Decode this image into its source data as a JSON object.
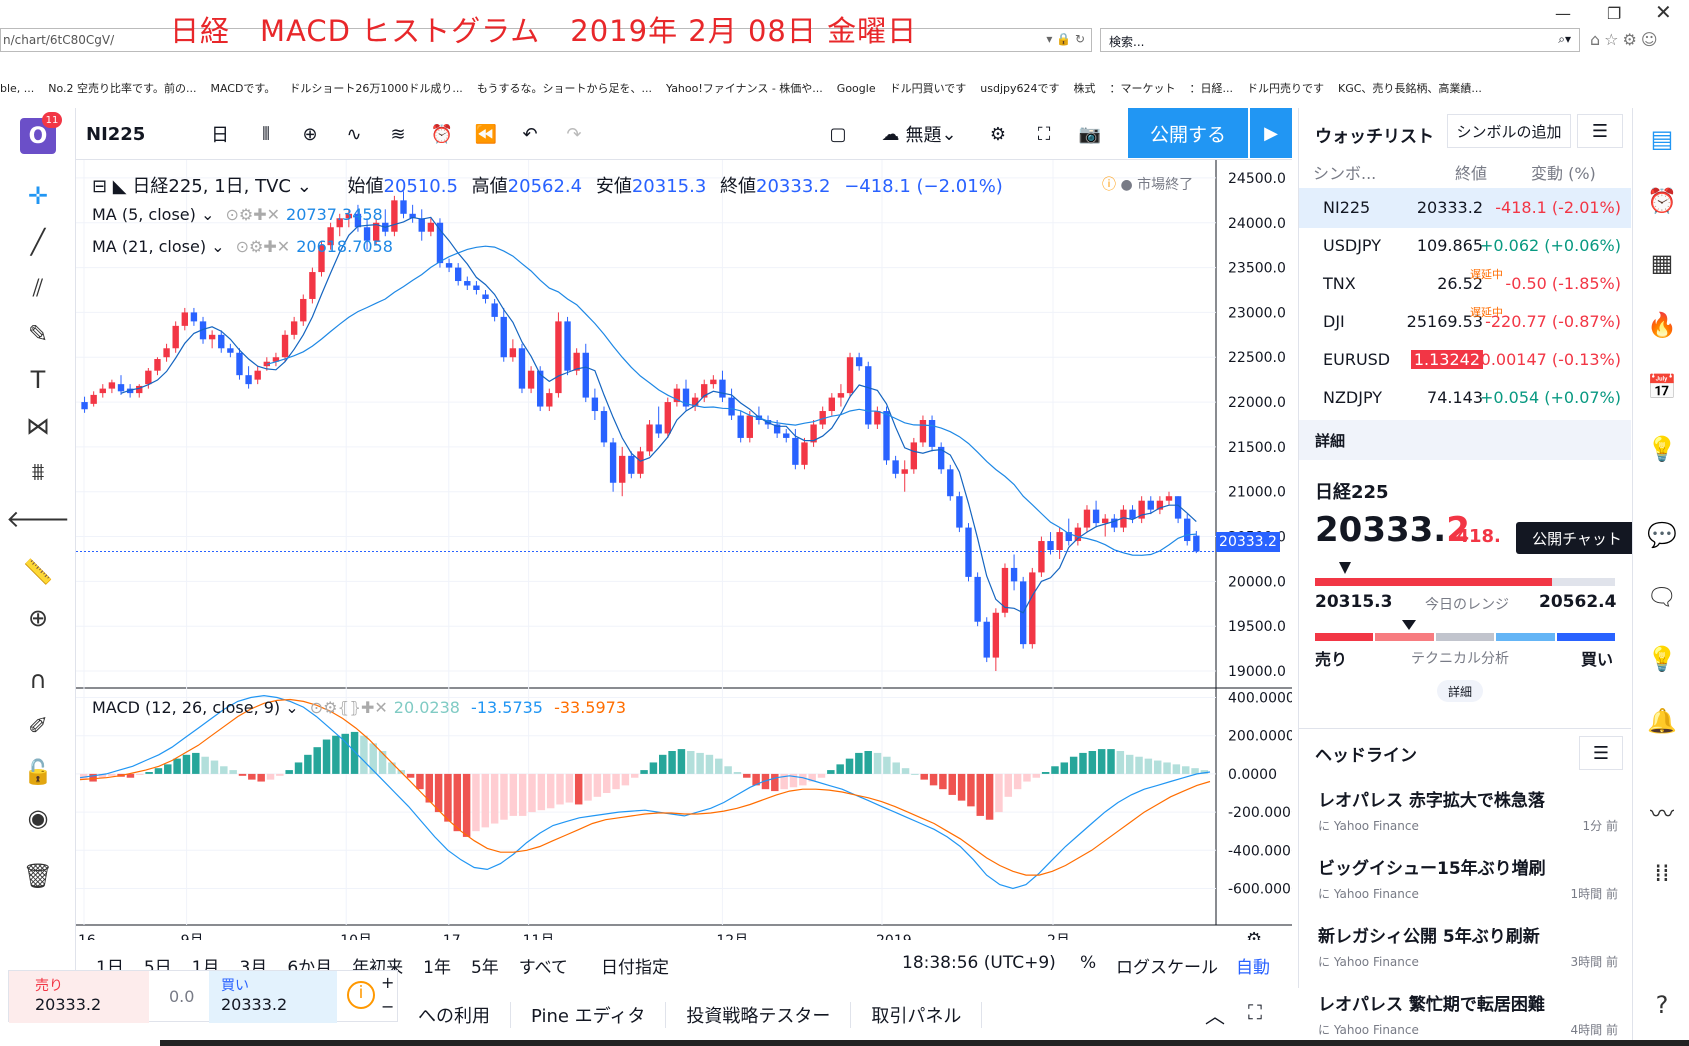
{
  "overlay_title": "日経　MACD ヒストグラム　2019年 2月 08日 金曜日",
  "browser": {
    "address": "n/chart/6tC80CgV/",
    "search_placeholder": "検索...",
    "bookmarks": [
      "ble, ...",
      "No.2 空売り比率です。前の...",
      "MACDです。",
      "ドルショート26万1000ドル成り...",
      "もうするな。ショートから足を、...",
      "Yahoo!ファイナンス - 株価や...",
      "Google",
      "ドル円買いです",
      "usdjpy624です",
      "株式",
      "：マーケット",
      "：日経...",
      "ドル円売りです",
      "KGC、売り長銘柄、高業績..."
    ]
  },
  "logo_badge": "11",
  "toolbar": {
    "symbol": "NI225",
    "interval": "日",
    "layout_name": "無題",
    "publish": "公開する"
  },
  "legend": {
    "symbol_line": "日経225, 1日, TVC",
    "open_label": "始値",
    "open": "20510.5",
    "high_label": "高値",
    "high": "20562.4",
    "low_label": "安値",
    "low": "20315.3",
    "close_label": "終値",
    "close": "20333.2",
    "change": "−418.1 (−2.01%)",
    "market_status": "市場終了",
    "ma5": "MA (5, close)",
    "ma5_val": "20737.3458",
    "ma21": "MA (21, close)",
    "ma21_val": "20618.7058",
    "macd": "MACD (12, 26, close, 9)",
    "macd_hist": "20.0238",
    "macd_line": "-13.5735",
    "macd_signal": "-33.5973"
  },
  "price_axis": [
    "24500.0",
    "24000.0",
    "23500.0",
    "23000.0",
    "22500.0",
    "22000.0",
    "21500.0",
    "21000.0",
    "20500.0",
    "20000.0",
    "19500.0",
    "19000.0"
  ],
  "last_price_tag": "20333.2",
  "macd_axis": [
    "400.0000",
    "200.0000",
    "0.0000",
    "-200.0000",
    "-400.0000",
    "-600.0000"
  ],
  "time_axis": [
    "16",
    "9月",
    "10月",
    "17",
    "11月",
    "12月",
    "2019",
    "2月"
  ],
  "range_buttons": [
    "1日",
    "5日",
    "1月",
    "3月",
    "6か月",
    "年初来",
    "1年",
    "5年",
    "すべて"
  ],
  "date_pick": "日付指定",
  "clock": "18:38:56 (UTC+9)",
  "scale_opts": {
    "percent": "%",
    "log": "ログスケール",
    "auto": "自動"
  },
  "trade": {
    "sell_label": "売り",
    "sell": "20333.2",
    "spread": "0.0",
    "buy_label": "買い",
    "buy": "20333.2"
  },
  "bottom_tabs": [
    "への利用",
    "Pine エディタ",
    "投資戦略テスター",
    "取引パネル"
  ],
  "watchlist": {
    "title": "ウォッチリスト",
    "add_symbol": "シンボルの追加",
    "col_symbol": "シンボ...",
    "col_last": "終値",
    "col_change": "変動 (%)",
    "rows": [
      {
        "sym": "NI225",
        "last": "20333.2",
        "chg": "-418.1 (-2.01%)",
        "color": "#f23645"
      },
      {
        "sym": "USDJPY",
        "last": "109.865",
        "chg": "+0.062 (+0.06%)",
        "color": "#089981"
      },
      {
        "sym": "TNX",
        "last": "26.52",
        "chg": "-0.50 (-1.85%)",
        "color": "#f23645",
        "tag": "遅延中"
      },
      {
        "sym": "DJI",
        "last": "25169.53",
        "chg": "-220.77 (-0.87%)",
        "color": "#f23645",
        "tag": "遅延中"
      },
      {
        "sym": "EURUSD",
        "last": "1.13242",
        "chg": "-0.00147 (-0.13%)",
        "color": "#f23645"
      },
      {
        "sym": "NZDJPY",
        "last": "74.143",
        "chg": "+0.054 (+0.07%)",
        "color": "#089981"
      }
    ]
  },
  "details": {
    "header": "詳細",
    "name": "日経225",
    "price_main": "20333.",
    "price_last": "2",
    "change": "-418.",
    "range_low": "20315.3",
    "range_label": "今日のレンジ",
    "range_high": "20562.4",
    "sell": "売り",
    "tech": "テクニカル分析",
    "buy": "買い",
    "more": "詳細"
  },
  "tooltip": "公開チャット",
  "headlines": {
    "title": "ヘッドライン",
    "items": [
      {
        "t": "レオパレス 赤字拡大で株急落",
        "src": "に Yahoo Finance",
        "time": "1分 前"
      },
      {
        "t": "ビッグイシュー15年ぶり増刷",
        "src": "に Yahoo Finance",
        "time": "1時間 前"
      },
      {
        "t": "新レガシィ公開 5年ぶり刷新",
        "src": "に Yahoo Finance",
        "time": "3時間 前"
      },
      {
        "t": "レオパレス 繁忙期で転居困難",
        "src": "に Yahoo Finance",
        "time": "4時間 前"
      }
    ]
  },
  "chart_data": {
    "type": "candlestick",
    "ylim": [
      18900,
      24700
    ],
    "macd_ylim": [
      -650,
      450
    ],
    "candles": [
      [
        22000,
        22060,
        21880,
        21920
      ],
      [
        21980,
        22120,
        21950,
        22080
      ],
      [
        22100,
        22200,
        22050,
        22150
      ],
      [
        22150,
        22250,
        22100,
        22220
      ],
      [
        22200,
        22300,
        22080,
        22120
      ],
      [
        22150,
        22200,
        22050,
        22100
      ],
      [
        22100,
        22200,
        22050,
        22180
      ],
      [
        22200,
        22380,
        22150,
        22350
      ],
      [
        22350,
        22500,
        22300,
        22480
      ],
      [
        22500,
        22650,
        22450,
        22600
      ],
      [
        22600,
        22900,
        22550,
        22850
      ],
      [
        22850,
        23050,
        22800,
        23000
      ],
      [
        23000,
        23050,
        22850,
        22900
      ],
      [
        22900,
        22950,
        22650,
        22700
      ],
      [
        22700,
        22800,
        22600,
        22750
      ],
      [
        22750,
        22800,
        22550,
        22600
      ],
      [
        22600,
        22650,
        22500,
        22550
      ],
      [
        22550,
        22600,
        22250,
        22300
      ],
      [
        22300,
        22400,
        22150,
        22200
      ],
      [
        22250,
        22400,
        22200,
        22350
      ],
      [
        22400,
        22500,
        22350,
        22450
      ],
      [
        22450,
        22550,
        22400,
        22500
      ],
      [
        22500,
        22800,
        22450,
        22750
      ],
      [
        22750,
        22950,
        22700,
        22900
      ],
      [
        22900,
        23200,
        22850,
        23150
      ],
      [
        23150,
        23500,
        23100,
        23450
      ],
      [
        23450,
        23800,
        23400,
        23750
      ],
      [
        23750,
        24000,
        23700,
        23950
      ],
      [
        23950,
        24100,
        23850,
        24050
      ],
      [
        24050,
        24150,
        23950,
        24100
      ],
      [
        24100,
        24200,
        23900,
        23950
      ],
      [
        23950,
        24050,
        23700,
        23800
      ],
      [
        23800,
        24050,
        23750,
        24000
      ],
      [
        24000,
        24150,
        23850,
        23900
      ],
      [
        23900,
        24300,
        23850,
        24250
      ],
      [
        24250,
        24350,
        24050,
        24100
      ],
      [
        24100,
        24200,
        24000,
        24050
      ],
      [
        24050,
        24150,
        23800,
        23900
      ],
      [
        23900,
        24050,
        23850,
        24000
      ],
      [
        24000,
        24050,
        23500,
        23550
      ],
      [
        23550,
        23600,
        23450,
        23500
      ],
      [
        23500,
        23550,
        23300,
        23350
      ],
      [
        23350,
        23400,
        23250,
        23300
      ],
      [
        23300,
        23350,
        23200,
        23250
      ],
      [
        23200,
        23250,
        23100,
        23150
      ],
      [
        23100,
        23150,
        22900,
        22950
      ],
      [
        22950,
        23050,
        22450,
        22500
      ],
      [
        22500,
        22700,
        22450,
        22600
      ],
      [
        22600,
        22650,
        22100,
        22150
      ],
      [
        22150,
        22400,
        22100,
        22350
      ],
      [
        22350,
        22400,
        21900,
        21950
      ],
      [
        21950,
        22150,
        21900,
        22100
      ],
      [
        22100,
        23000,
        22050,
        22900
      ],
      [
        22900,
        22950,
        22300,
        22350
      ],
      [
        22350,
        22600,
        22300,
        22550
      ],
      [
        22550,
        22650,
        22000,
        22050
      ],
      [
        22050,
        22150,
        21800,
        21900
      ],
      [
        21900,
        21950,
        21500,
        21550
      ],
      [
        21550,
        21600,
        21000,
        21100
      ],
      [
        21100,
        21500,
        20950,
        21400
      ],
      [
        21400,
        21450,
        21150,
        21200
      ],
      [
        21200,
        21500,
        21150,
        21450
      ],
      [
        21450,
        21800,
        21400,
        21750
      ],
      [
        21750,
        21950,
        21600,
        21650
      ],
      [
        21650,
        22050,
        21600,
        22000
      ],
      [
        22000,
        22200,
        21950,
        22150
      ],
      [
        22150,
        22250,
        21900,
        21950
      ],
      [
        21950,
        22100,
        21900,
        22050
      ],
      [
        22050,
        22250,
        22000,
        22200
      ],
      [
        22200,
        22300,
        22150,
        22250
      ],
      [
        22250,
        22350,
        22000,
        22050
      ],
      [
        22050,
        22150,
        21800,
        21850
      ],
      [
        21850,
        21900,
        21550,
        21600
      ],
      [
        21600,
        21900,
        21550,
        21850
      ],
      [
        21850,
        21950,
        21750,
        21800
      ],
      [
        21800,
        21850,
        21700,
        21750
      ],
      [
        21750,
        21800,
        21600,
        21650
      ],
      [
        21650,
        21700,
        21550,
        21600
      ],
      [
        21600,
        21700,
        21250,
        21300
      ],
      [
        21300,
        21600,
        21250,
        21550
      ],
      [
        21550,
        21800,
        21500,
        21750
      ],
      [
        21750,
        21950,
        21700,
        21900
      ],
      [
        21900,
        22100,
        21850,
        22050
      ],
      [
        22050,
        22200,
        21950,
        22100
      ],
      [
        22100,
        22550,
        22050,
        22500
      ],
      [
        22500,
        22550,
        22350,
        22400
      ],
      [
        22400,
        22450,
        21700,
        21750
      ],
      [
        21750,
        21950,
        21700,
        21900
      ],
      [
        21900,
        21950,
        21300,
        21350
      ],
      [
        21350,
        21400,
        21150,
        21200
      ],
      [
        21200,
        21350,
        21000,
        21250
      ],
      [
        21250,
        21600,
        21200,
        21550
      ],
      [
        21550,
        21850,
        21500,
        21800
      ],
      [
        21800,
        21850,
        21450,
        21500
      ],
      [
        21500,
        21550,
        21200,
        21250
      ],
      [
        21250,
        21300,
        20900,
        20950
      ],
      [
        20950,
        21000,
        20550,
        20600
      ],
      [
        20600,
        20650,
        20000,
        20050
      ],
      [
        20050,
        20100,
        19500,
        19550
      ],
      [
        19550,
        19600,
        19100,
        19150
      ],
      [
        19150,
        19700,
        19000,
        19650
      ],
      [
        19650,
        20200,
        19600,
        20150
      ],
      [
        20150,
        20300,
        19900,
        20000
      ],
      [
        20000,
        20050,
        19250,
        19300
      ],
      [
        19300,
        20150,
        19250,
        20100
      ],
      [
        20100,
        20500,
        20050,
        20450
      ],
      [
        20450,
        20550,
        20300,
        20350
      ],
      [
        20350,
        20600,
        20250,
        20550
      ],
      [
        20550,
        20700,
        20400,
        20450
      ],
      [
        20450,
        20650,
        20400,
        20600
      ],
      [
        20600,
        20850,
        20550,
        20800
      ],
      [
        20800,
        20900,
        20600,
        20650
      ],
      [
        20650,
        20750,
        20500,
        20700
      ],
      [
        20700,
        20750,
        20550,
        20600
      ],
      [
        20600,
        20850,
        20550,
        20800
      ],
      [
        20800,
        20850,
        20650,
        20700
      ],
      [
        20700,
        20950,
        20650,
        20900
      ],
      [
        20900,
        20950,
        20750,
        20800
      ],
      [
        20800,
        20950,
        20750,
        20900
      ],
      [
        20900,
        21000,
        20850,
        20950
      ],
      [
        20950,
        20950,
        20650,
        20700
      ],
      [
        20700,
        20750,
        20400,
        20450
      ],
      [
        20510.5,
        20562.4,
        20315.3,
        20333.2
      ]
    ],
    "macd_hist": [
      -30,
      -40,
      -20,
      -10,
      -15,
      -20,
      -5,
      10,
      30,
      50,
      80,
      100,
      110,
      90,
      70,
      40,
      20,
      -10,
      -30,
      -40,
      -30,
      -10,
      20,
      60,
      100,
      140,
      180,
      200,
      210,
      220,
      200,
      160,
      120,
      60,
      20,
      -20,
      -80,
      -150,
      -200,
      -250,
      -300,
      -330,
      -300,
      -280,
      -260,
      -240,
      -220,
      -220,
      -200,
      -190,
      -180,
      -160,
      -150,
      -160,
      -140,
      -120,
      -100,
      -80,
      -60,
      -20,
      20,
      60,
      100,
      120,
      130,
      120,
      110,
      100,
      80,
      40,
      10,
      -20,
      -60,
      -80,
      -90,
      -80,
      -70,
      -60,
      -40,
      -20,
      20,
      50,
      80,
      110,
      120,
      110,
      90,
      60,
      30,
      0,
      -30,
      -60,
      -80,
      -110,
      -140,
      -170,
      -220,
      -240,
      -200,
      -120,
      -80,
      -40,
      -20,
      10,
      40,
      60,
      90,
      110,
      120,
      130,
      130,
      120,
      100,
      90,
      80,
      70,
      60,
      50,
      40,
      30,
      20
    ],
    "macd_line": [
      -20,
      -10,
      0,
      20,
      40,
      70,
      100,
      140,
      190,
      240,
      290,
      340,
      380,
      400,
      410,
      400,
      380,
      350,
      300,
      240,
      180,
      110,
      40,
      -30,
      -100,
      -170,
      -250,
      -330,
      -400,
      -450,
      -490,
      -500,
      -470,
      -420,
      -360,
      -310,
      -270,
      -250,
      -230,
      -220,
      -210,
      -200,
      -195,
      -190,
      -200,
      -210,
      -220,
      -200,
      -180,
      -150,
      -110,
      -70,
      -40,
      -20,
      -10,
      -20,
      -40,
      -60,
      -80,
      -110,
      -140,
      -170,
      -200,
      -230,
      -260,
      -290,
      -330,
      -380,
      -450,
      -530,
      -580,
      -600,
      -580,
      -520,
      -450,
      -380,
      -320,
      -260,
      -200,
      -150,
      -110,
      -80,
      -60,
      -40,
      -20,
      0,
      10
    ],
    "signal_line": [
      -30,
      -25,
      -20,
      -10,
      5,
      20,
      40,
      70,
      110,
      150,
      200,
      250,
      300,
      340,
      370,
      385,
      390,
      380,
      360,
      330,
      290,
      240,
      180,
      110,
      40,
      -30,
      -100,
      -170,
      -240,
      -300,
      -350,
      -390,
      -410,
      -410,
      -400,
      -380,
      -350,
      -320,
      -290,
      -260,
      -240,
      -230,
      -220,
      -210,
      -205,
      -205,
      -210,
      -210,
      -205,
      -195,
      -180,
      -160,
      -135,
      -110,
      -90,
      -80,
      -80,
      -85,
      -95,
      -110,
      -125,
      -145,
      -170,
      -200,
      -230,
      -260,
      -300,
      -340,
      -390,
      -440,
      -480,
      -510,
      -530,
      -530,
      -510,
      -480,
      -440,
      -400,
      -350,
      -300,
      -250,
      -200,
      -160,
      -120,
      -90,
      -60,
      -40
    ]
  }
}
